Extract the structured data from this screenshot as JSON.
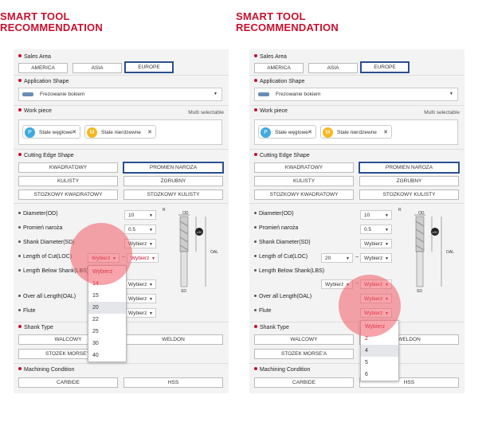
{
  "title_line1": "SMART TOOL",
  "title_line2": "RECOMMENDATION",
  "sales_area": {
    "label": "Sales Area",
    "options": [
      "AMERICA",
      "ASIA",
      "EUROPE"
    ],
    "selected": "EUROPE"
  },
  "application_shape": {
    "label": "Application Shape",
    "value": "Frezowanie bokiem"
  },
  "work_piece": {
    "label": "Work piece",
    "hint": "Multi selectable",
    "chips": [
      {
        "badge": "P",
        "label": "Stale węglowe",
        "color": "#3fa9e0"
      },
      {
        "badge": "M",
        "label": "Stale nierdzewne",
        "color": "#f5b820"
      }
    ]
  },
  "cutting_edge": {
    "label": "Cutting Edge Shape",
    "options": [
      "KWADRATOWY",
      "PROMIEN NAROZA",
      "KULISTY",
      "ZGRUBNY",
      "STOZKOWY KWADRATOWY",
      "STOZKOWY KULISTY"
    ],
    "selected": "PROMIEN NAROZA"
  },
  "params": {
    "diameter": {
      "label": "Diameter(OD)",
      "value": "10"
    },
    "corner_radius": {
      "label": "Promień naroża",
      "value": "0.5"
    },
    "shank_diameter": {
      "label": "Shank Diameter(SD)",
      "value": "Wybierz"
    },
    "length_of_cut": {
      "label": "Length of Cut(LOC)"
    },
    "length_below_shank": {
      "label": "Length Below Shank(LBS)"
    },
    "overall_length": {
      "label": "Over all Length(OAL)"
    },
    "flute": {
      "label": "Flute"
    }
  },
  "placeholder": "Wybierz",
  "tilde": "~",
  "shank_type": {
    "label": "Shank Type",
    "options": [
      "WALCOWY",
      "WELDON",
      "STOZEK MORSE'A"
    ]
  },
  "machining_condition": {
    "label": "Machining Condition",
    "options": [
      "CARBIDE",
      "HSS"
    ]
  },
  "diagram_labels": {
    "r": "R",
    "od": "OD",
    "loc": "LOC",
    "oal": "OAL",
    "sd": "SD"
  },
  "left_panel": {
    "loc_from": "Wybierz",
    "loc_to": "Wybierz",
    "lbs_value": "Wybierz",
    "oal_value": "Wybierz",
    "flute_value": "Wybierz",
    "dropdown_options": [
      "Wybierz",
      "14",
      "15",
      "20",
      "22",
      "25",
      "30",
      "40"
    ],
    "dropdown_selected": "20"
  },
  "right_panel": {
    "loc_from": "20",
    "loc_to": "Wybierz",
    "lbs_from": "Wybierz",
    "lbs_to": "Wybierz",
    "oal_value": "Wybierz",
    "flute_value": "Wybierz",
    "dropdown_options": [
      "Wybierz",
      "2",
      "4",
      "5",
      "6"
    ],
    "dropdown_selected": "4"
  },
  "colors": {
    "accent": "#c8102e",
    "active_border": "#2a4f8f",
    "panel_bg": "#f3f3f3",
    "halo": "#f05a64"
  }
}
